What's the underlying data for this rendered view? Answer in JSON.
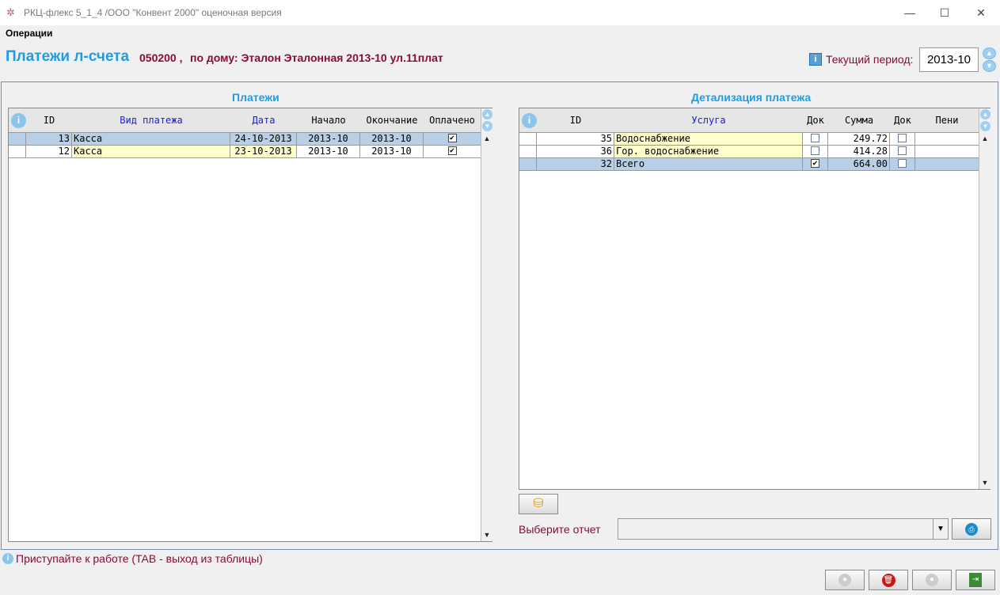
{
  "window": {
    "title": "РКЦ-флекс 5_1_4    /ООО \"Конвент 2000\" оценочная версия",
    "minimize": "—",
    "maximize": "☐",
    "close": "✕"
  },
  "menu": {
    "operations": "Операции"
  },
  "header": {
    "title": "Платежи л-счета",
    "account": "050200 ,",
    "house": "по дому: Эталон Эталонная 2013-10 ул.11плат",
    "period_label": "Текущий период:",
    "period_value": "2013-10"
  },
  "payments": {
    "title": "Платежи",
    "columns": [
      "ID",
      "Вид платежа",
      "Дата",
      "Начало",
      "Окончание",
      "Оплачено"
    ],
    "rows": [
      {
        "id": "13",
        "type": "Касса",
        "date": "24-10-2013",
        "start": "2013-10",
        "end": "2013-10",
        "paid": true
      },
      {
        "id": "12",
        "type": "Касса",
        "date": "23-10-2013",
        "start": "2013-10",
        "end": "2013-10",
        "paid": true
      }
    ]
  },
  "details": {
    "title": "Детализация платежа",
    "columns": [
      "ID",
      "Услуга",
      "Док",
      "Сумма",
      "Док",
      "Пени"
    ],
    "rows": [
      {
        "id": "35",
        "service": "Водоснабжение",
        "doc": false,
        "sum": "249.72",
        "doc2": false,
        "penalty": ""
      },
      {
        "id": "36",
        "service": "Гор. водоснабжение",
        "doc": false,
        "sum": "414.28",
        "doc2": false,
        "penalty": ""
      },
      {
        "id": "32",
        "service": "Всего",
        "doc": true,
        "sum": "664.00",
        "doc2": false,
        "penalty": ""
      }
    ]
  },
  "report": {
    "label": "Выберите отчет",
    "selected": ""
  },
  "status": {
    "message": "Приступайте к работе (TAB - выход из таблицы)"
  },
  "icons": {
    "info": "info-icon",
    "coins": "coins-icon",
    "print": "print-icon",
    "delete": "delete-icon",
    "exit": "exit-icon"
  },
  "colors": {
    "title_blue": "#1e9de3",
    "label_maroon": "#8b0a3a",
    "selected_row": "#b9cfe6",
    "yellow_cell": "#ffffcc",
    "header_link_blue": "#1c1cd8"
  }
}
